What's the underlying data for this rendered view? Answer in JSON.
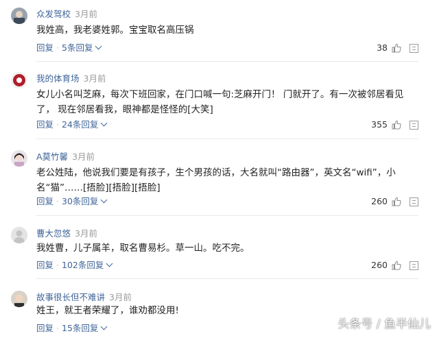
{
  "comments": [
    {
      "username": "众发驾校",
      "time": "3月前",
      "text": "我姓高，我老婆姓郭。宝宝取名高压锅",
      "reply_label": "回复",
      "replies_label": "5条回复",
      "likes": "38"
    },
    {
      "username": "我的体育场",
      "time": "3月前",
      "text": "女儿小名叫芝麻，每次下班回家，在门口喊一句:芝麻开门！ 门就开了。有一次被邻居看见了， 现在邻居看我，眼神都是怪怪的[大笑]",
      "reply_label": "回复",
      "replies_label": "24条回复",
      "likes": "355"
    },
    {
      "username": "A莫竹馨",
      "time": "3月前",
      "text": "老公姓陆，他说我们要是有孩子，生个男孩的话，大名就叫“路由器”，英文名“wifi”，小名“猫”……[捂脸][捂脸][捂脸]",
      "reply_label": "回复",
      "replies_label": "30条回复",
      "likes": "260"
    },
    {
      "username": "曹大忽悠",
      "time": "3月前",
      "text": "我姓曹，儿子属羊，取名曹易杉。草一山。吃不完。",
      "reply_label": "回复",
      "replies_label": "102条回复",
      "likes": "260"
    },
    {
      "username": "故事很长但不难讲",
      "time": "3月前",
      "text": "姓王，就王者荣耀了，谁劝都没用!",
      "reply_label": "回复",
      "replies_label": "15条回复",
      "likes": ""
    }
  ],
  "watermark": "头条号 / 鱼半仙儿",
  "colors": {
    "link": "#406599",
    "muted": "#999999",
    "text": "#222222"
  }
}
